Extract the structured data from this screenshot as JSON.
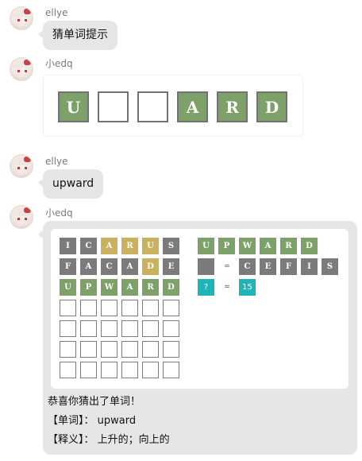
{
  "messages": [
    {
      "sender": "ellye",
      "text": "猜单词提示"
    },
    {
      "sender": "小edq"
    },
    {
      "sender": "ellye",
      "text": "upward"
    },
    {
      "sender": "小edq"
    }
  ],
  "hint": {
    "tiles": [
      "U",
      "",
      "",
      "A",
      "R",
      "D"
    ],
    "states": [
      "green",
      "empty",
      "empty",
      "green",
      "green",
      "green"
    ]
  },
  "game": {
    "rows": [
      {
        "letters": [
          "I",
          "C",
          "A",
          "R",
          "U",
          "S"
        ],
        "states": [
          "x",
          "x",
          "y",
          "y",
          "y",
          "x"
        ]
      },
      {
        "letters": [
          "F",
          "A",
          "C",
          "A",
          "D",
          "E"
        ],
        "states": [
          "x",
          "x",
          "x",
          "x",
          "y",
          "x"
        ]
      },
      {
        "letters": [
          "U",
          "P",
          "W",
          "A",
          "R",
          "D"
        ],
        "states": [
          "g",
          "g",
          "g",
          "g",
          "g",
          "g"
        ]
      },
      {
        "letters": [
          "",
          "",
          "",
          "",
          "",
          ""
        ],
        "states": [
          "e",
          "e",
          "e",
          "e",
          "e",
          "e"
        ]
      },
      {
        "letters": [
          "",
          "",
          "",
          "",
          "",
          ""
        ],
        "states": [
          "e",
          "e",
          "e",
          "e",
          "e",
          "e"
        ]
      },
      {
        "letters": [
          "",
          "",
          "",
          "",
          "",
          ""
        ],
        "states": [
          "e",
          "e",
          "e",
          "e",
          "e",
          "e"
        ]
      },
      {
        "letters": [
          "",
          "",
          "",
          "",
          "",
          ""
        ],
        "states": [
          "e",
          "e",
          "e",
          "e",
          "e",
          "e"
        ]
      }
    ],
    "summary": {
      "known": [
        "U",
        "P",
        "W",
        "A",
        "R",
        "D"
      ],
      "eliminated_symbol": "=",
      "eliminated": [
        "C",
        "E",
        "F",
        "I",
        "S"
      ],
      "unknown_symbol": "?",
      "unknown_equals": "=",
      "attempts_left": "15"
    },
    "result": {
      "congrats": "恭喜你猜出了单词！",
      "word_label": "【单词】：",
      "word": "upward",
      "meaning_label": "【释义】：",
      "meaning": "上升的；向上的"
    }
  },
  "colors": {
    "green": "#7ea16a",
    "yellow": "#c9b15e",
    "gray": "#7b7b7b",
    "cyan": "#1fb4b8",
    "bubble": "#e6e6e6"
  }
}
